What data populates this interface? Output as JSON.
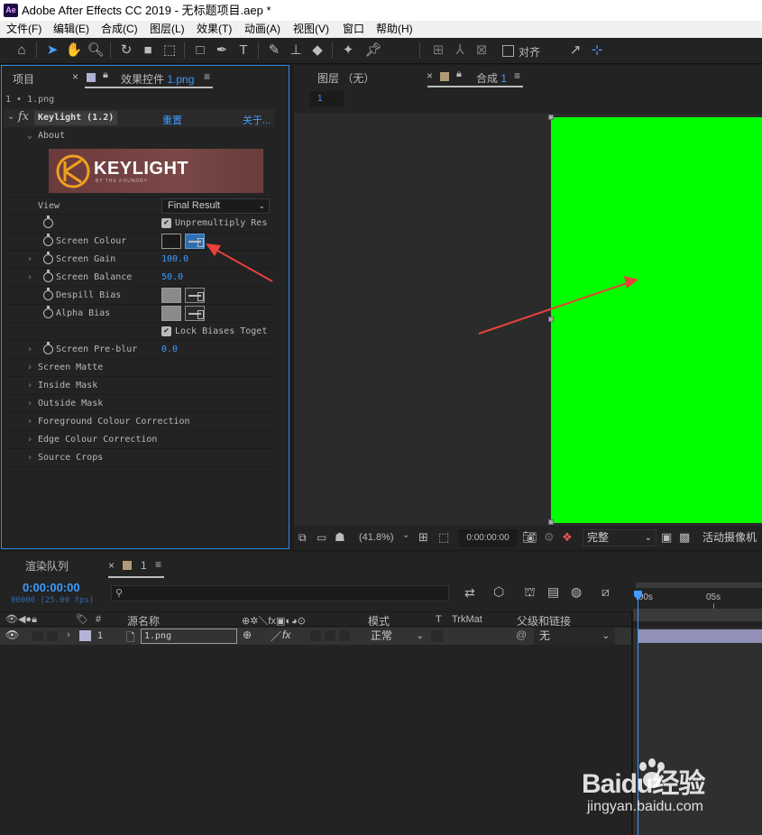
{
  "window": {
    "app_icon": "Ae",
    "title": "Adobe After Effects CC 2019 - 无标题项目.aep *"
  },
  "menu": [
    "文件(F)",
    "编辑(E)",
    "合成(C)",
    "图层(L)",
    "效果(T)",
    "动画(A)",
    "视图(V)",
    "窗口",
    "帮助(H)"
  ],
  "toolbar": {
    "snap_label": "对齐"
  },
  "left_panel": {
    "tab_project": "项目",
    "tab_effects_prefix": "效果控件",
    "tab_effects_layer": "1.png",
    "breadcrumb": "1 • 1.png",
    "effect_name": "Keylight (1.2)",
    "reset_label": "重置",
    "about_link": "关于...",
    "about_section": "About",
    "logo_text": "KEYLIGHT",
    "logo_sub": "BY THE FOUNDRY",
    "view_label": "View",
    "view_value": "Final Result",
    "unpremultiply_label": "Unpremultiply Res",
    "screen_colour_label": "Screen Colour",
    "screen_gain_label": "Screen Gain",
    "screen_gain_value": "100.0",
    "screen_balance_label": "Screen Balance",
    "screen_balance_value": "50.0",
    "despill_bias_label": "Despill Bias",
    "alpha_bias_label": "Alpha Bias",
    "lock_biases_label": "Lock Biases Toget",
    "screen_preblur_label": "Screen Pre-blur",
    "screen_preblur_value": "0.0",
    "groups": [
      "Screen Matte",
      "Inside Mask",
      "Outside Mask",
      "Foreground Colour Correction",
      "Edge Colour Correction",
      "Source Crops"
    ]
  },
  "viewer": {
    "tab_layer": "图层 （无）",
    "tab_comp_prefix": "合成",
    "tab_comp_num": "1",
    "comp_chip": "1",
    "zoom": "(41.8%)",
    "timecode": "0:00:00:00",
    "quality": "完整",
    "camera": "活动摄像机"
  },
  "timeline": {
    "tab_render": "渲染队列",
    "tab_comp": "1",
    "timecode": "0:00:00:00",
    "frames": "00000 (25.00 fps)",
    "col_hash": "#",
    "col_source": "源名称",
    "col_mode": "模式",
    "col_t": "T",
    "col_trkmat": "TrkMat",
    "col_parent": "父级和链接",
    "ruler_0": ":00s",
    "ruler_5": "05s",
    "layer": {
      "num": "1",
      "name": "1.png",
      "mode": "正常",
      "parent": "无"
    }
  },
  "watermark": {
    "brand": "Baidu经验",
    "url": "jingyan.baidu.com"
  },
  "colors": {
    "accent": "#2d8ceb",
    "green_screen": "#00ff00",
    "annotation_arrow": "#e8413a",
    "layer_label": "#b4b4d8",
    "clip_bar": "#9090b8"
  }
}
